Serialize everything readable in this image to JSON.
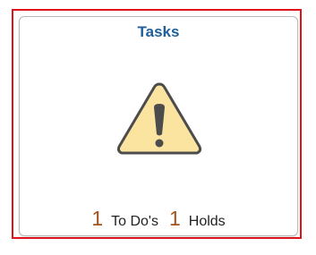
{
  "tile": {
    "title": "Tasks",
    "icon": "warning-icon",
    "counts": [
      {
        "value": "1",
        "label": "To Do's"
      },
      {
        "value": "1",
        "label": "Holds"
      }
    ]
  },
  "colors": {
    "title": "#1f5f99",
    "count_number": "#a0531a",
    "warning_fill": "#fbe3a0",
    "warning_stroke": "#4c4c4c",
    "highlight_frame": "#e0131b"
  }
}
